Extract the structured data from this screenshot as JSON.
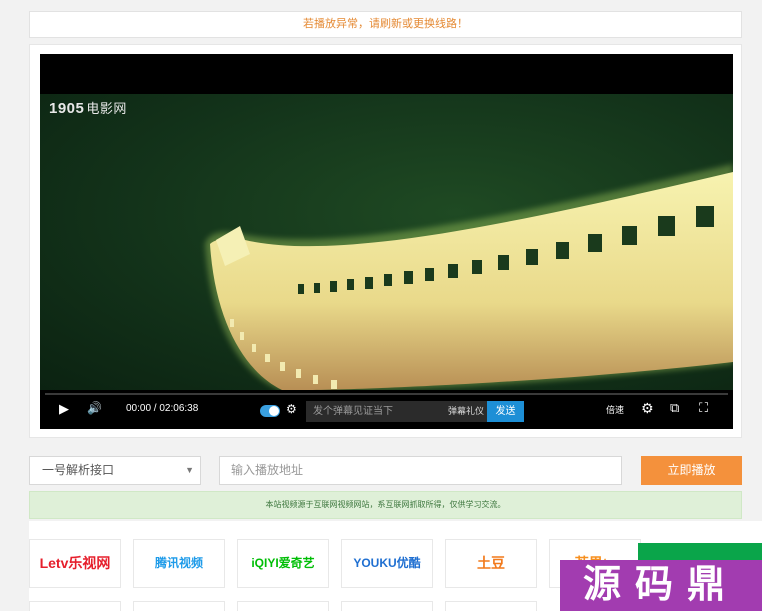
{
  "notice": {
    "text": "若播放异常，请刷新或更换线路！"
  },
  "player": {
    "channel_logo": {
      "mark": "1905",
      "name": "电影网"
    },
    "controls": {
      "time": "00:00 / 02:06:38",
      "danmaku_placeholder": "发个弹幕见证当下",
      "danmaku_gift": "弹幕礼仪",
      "send_label": "发送",
      "speed_label": "倍速"
    },
    "icons": [
      "play-icon",
      "volume-icon",
      "danmaku-toggle",
      "danmaku-settings-icon",
      "settings-icon",
      "pip-icon",
      "fullscreen-icon"
    ]
  },
  "parser": {
    "selected": "一号解析接口",
    "url_placeholder": "输入播放地址",
    "play_label": "立即播放"
  },
  "disclaimer": {
    "text": "本站视频源于互联网视频网站，系互联网抓取所得，仅供学习交流。"
  },
  "platforms": [
    {
      "name": "Letv乐视网",
      "color": "#e61e2b"
    },
    {
      "name": "腾讯视频",
      "color": "#1e9be9"
    },
    {
      "name": "iQIYI爱奇艺",
      "color": "#00be06"
    },
    {
      "name": "YOUKU优酷",
      "color": "#1f6fd1"
    },
    {
      "name": "土豆",
      "color": "#f27a1c"
    },
    {
      "name": "芒果tv",
      "color": "#f79020"
    }
  ],
  "watermark": {
    "text": "源码鼎"
  },
  "colors": {
    "accent": "#f4913c",
    "send": "#1d8fd6",
    "notice": "#e58a34"
  }
}
